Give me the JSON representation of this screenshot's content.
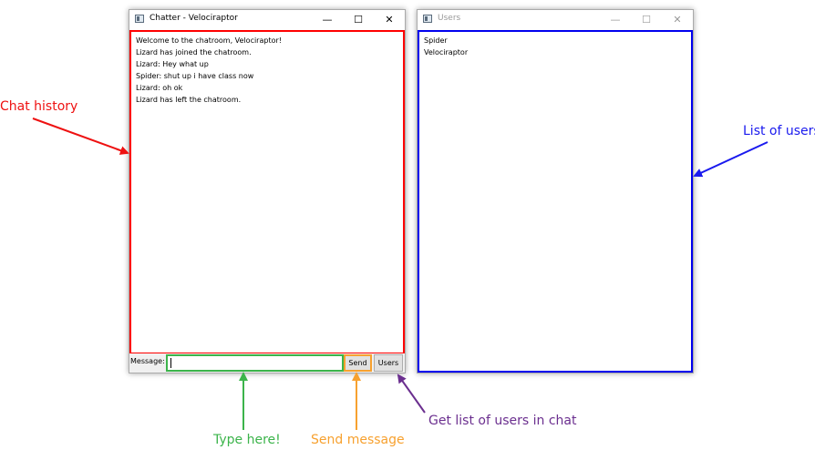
{
  "chat_window": {
    "title": "Chatter - Velociraptor",
    "minimize_glyph": "—",
    "maximize_glyph": "☐",
    "close_glyph": "✕",
    "messages": [
      "Welcome to the chatroom, Velociraptor!",
      "Lizard has joined the chatroom.",
      "Lizard: Hey what up",
      "Spider: shut up i have class now",
      "Lizard: oh ok",
      "Lizard has left the chatroom."
    ],
    "message_label": "Message:",
    "message_input_value": "",
    "send_label": "Send",
    "users_label": "Users"
  },
  "users_window": {
    "title": "Users",
    "minimize_glyph": "—",
    "maximize_glyph": "☐",
    "close_glyph": "✕",
    "users": [
      "Spider",
      "Velociraptor"
    ]
  },
  "annotations": {
    "chat_history": "Chat history",
    "list_of_users": "List of users",
    "type_here": "Type here!",
    "send_message": "Send message",
    "get_users": "Get list of users in chat"
  },
  "colors": {
    "chat_history": "#ee1111",
    "list_of_users": "#1a1aee",
    "type_here": "#3cb44b",
    "send_message": "#f7a12f",
    "get_users": "#6b2f8f"
  }
}
